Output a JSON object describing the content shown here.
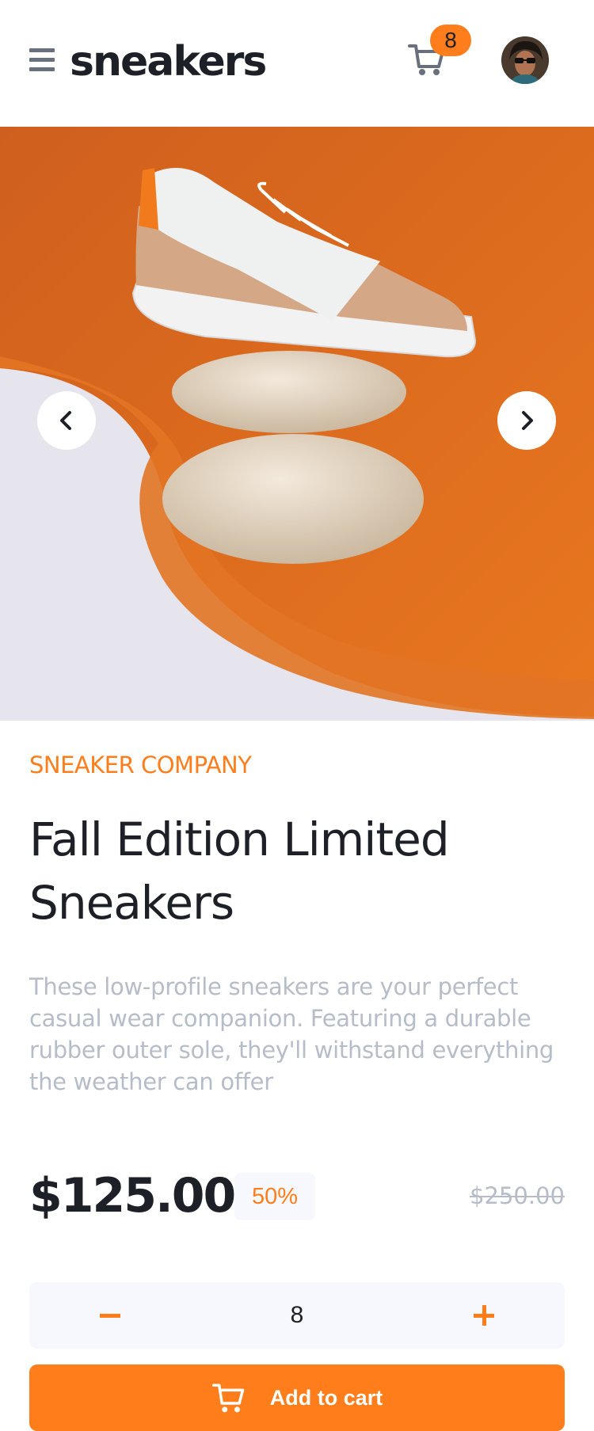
{
  "header": {
    "logo": "sneakers",
    "menu_icon": "hamburger-menu-icon",
    "cart_icon": "cart-icon",
    "cart_count": "8",
    "avatar_icon": "user-avatar"
  },
  "gallery": {
    "prev_icon": "chevron-left-icon",
    "next_icon": "chevron-right-icon"
  },
  "product": {
    "company": "SNEAKER COMPANY",
    "title": "Fall Edition Limited Sneakers",
    "description": "These low-profile sneakers are your perfect casual wear companion. Featuring a durable rubber outer sole, they'll withstand everything the weather can offer",
    "price": "$125.00",
    "discount": "50%",
    "original_price": "$250.00"
  },
  "quantity": {
    "value": "8",
    "minus_icon": "minus-icon",
    "plus_icon": "plus-icon"
  },
  "cart_button": {
    "label": "Add to cart",
    "icon": "cart-icon"
  },
  "colors": {
    "accent": "#ff7e1b",
    "text_dark": "#1d2026",
    "text_muted": "#b6bcc8",
    "surface_light": "#f6f8fd"
  }
}
